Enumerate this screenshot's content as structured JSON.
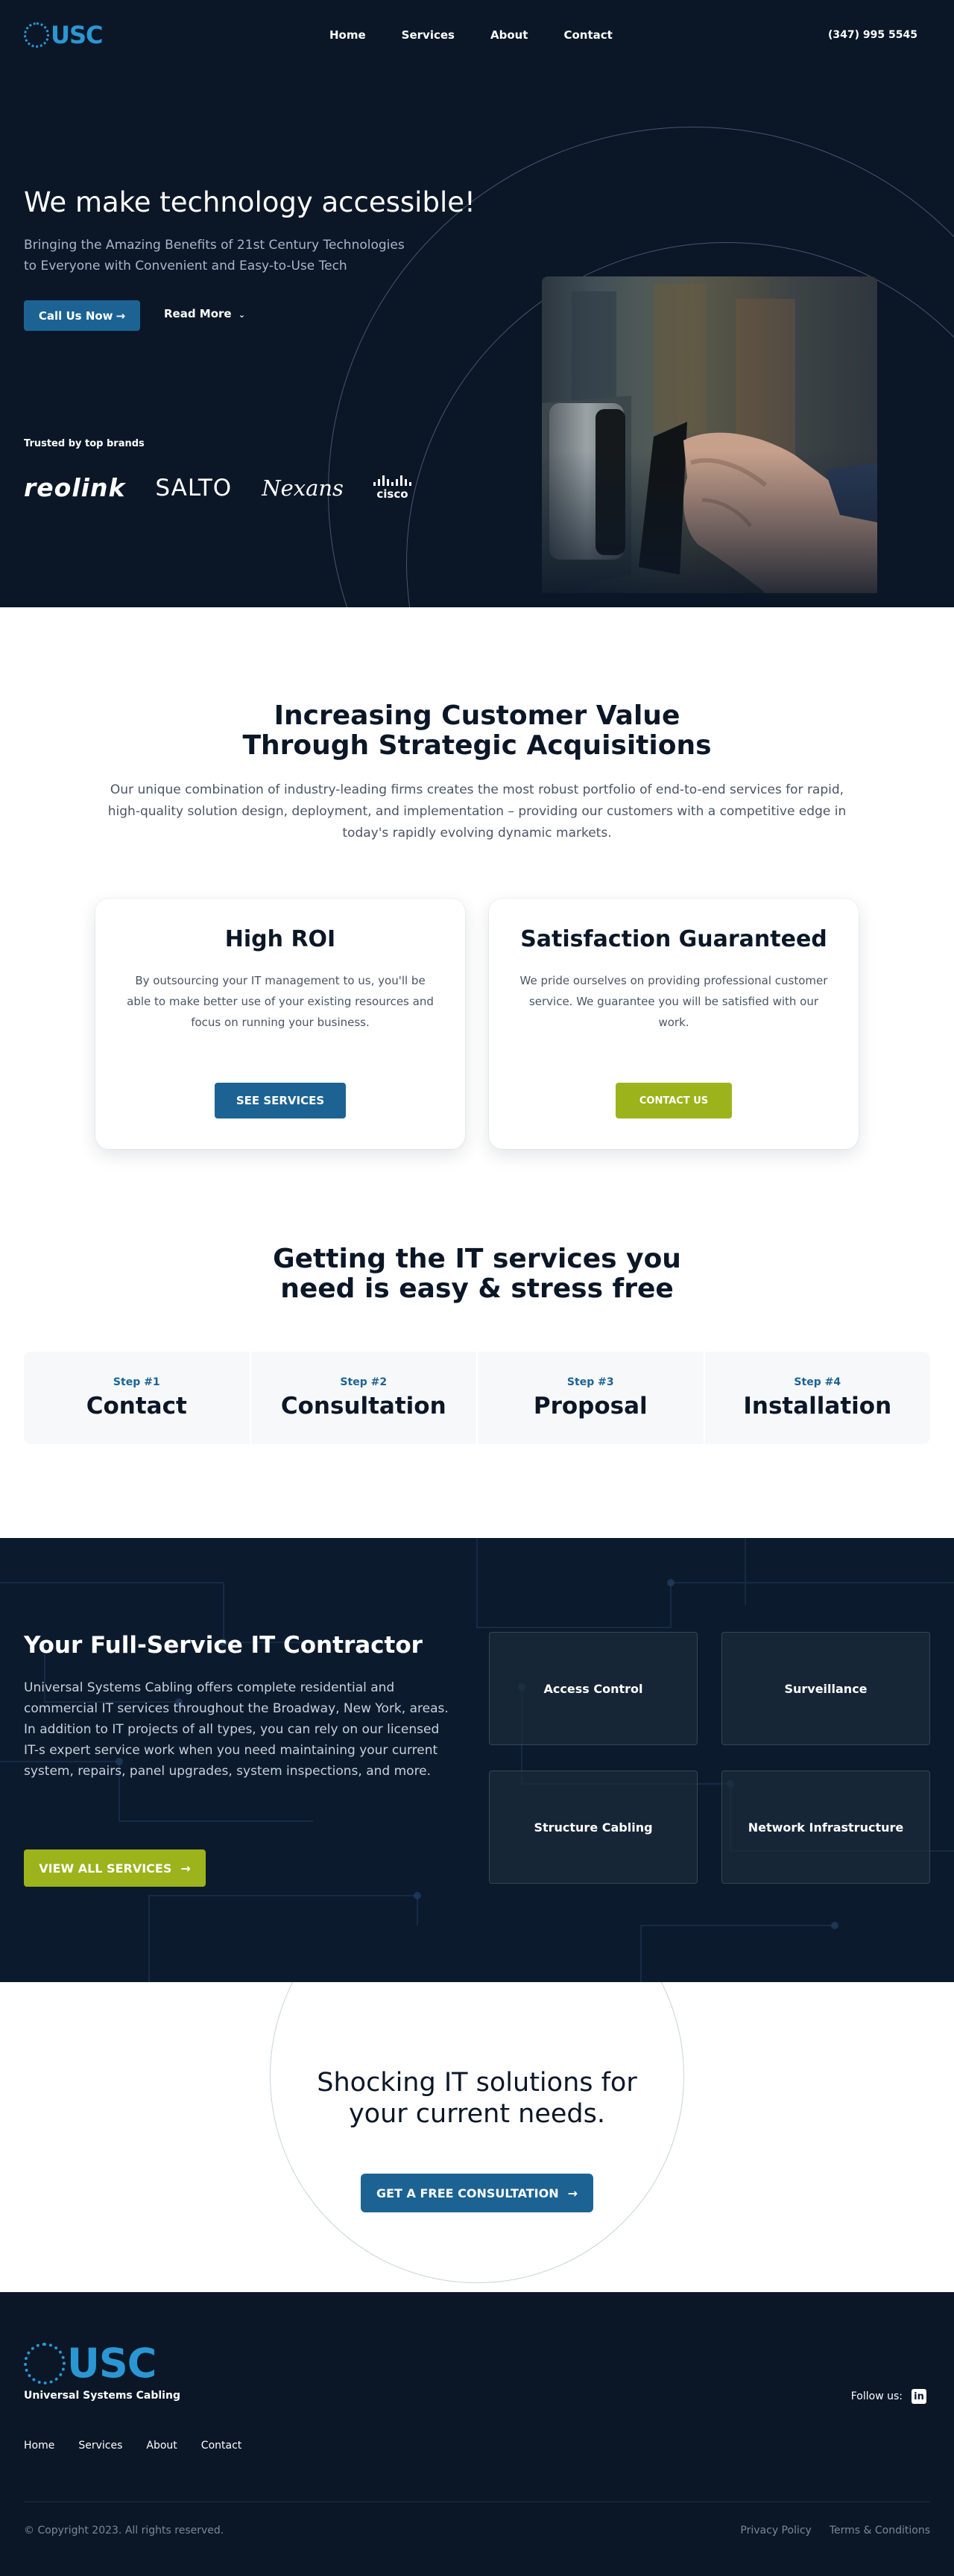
{
  "nav": {
    "logo": "USC",
    "links": [
      "Home",
      "Services",
      "About",
      "Contact"
    ],
    "phone": "(347) 995 5545"
  },
  "hero": {
    "title": "We make technology accessible!",
    "subtitle_line1": "Bringing the Amazing Benefits of 21st Century Technologies",
    "subtitle_line2": "to Everyone with Convenient and Easy-to-Use Tech",
    "cta_primary": "Call Us Now",
    "cta_secondary": "Read More",
    "trusted_label": "Trusted by top brands",
    "brands": [
      "reolink",
      "SALTO",
      "Nexans",
      "cisco"
    ]
  },
  "acquisitions": {
    "title_line1": "Increasing Customer Value",
    "title_line2": "Through Strategic Acquisitions",
    "lead": "Our unique combination of industry-leading firms creates the most robust portfolio of end-to-end services for rapid, high-quality solution design, deployment, and implementation – providing our customers with a competitive edge in today's rapidly evolving dynamic markets.",
    "cards": [
      {
        "title": "High ROI",
        "text": "By outsourcing your IT management to us, you'll be able to make better use of your existing resources and focus on running your business.",
        "button": "SEE SERVICES"
      },
      {
        "title": "Satisfaction Guaranteed",
        "text": "We pride ourselves on providing professional customer service. We guarantee you will be satisfied with our work.",
        "button": "CONTACT US"
      }
    ]
  },
  "steps": {
    "title_line1": "Getting the IT services you",
    "title_line2": "need is easy & stress free",
    "items": [
      {
        "num": "Step #1",
        "name": "Contact"
      },
      {
        "num": "Step #2",
        "name": "Consultation"
      },
      {
        "num": "Step #3",
        "name": "Proposal"
      },
      {
        "num": "Step #4",
        "name": "Installation"
      }
    ]
  },
  "contractor": {
    "title": "Your Full-Service IT Contractor",
    "text": "Universal Systems Cabling offers complete residential and commercial IT services throughout the Broadway, New York, areas. In addition to IT projects of all types, you can rely on our licensed IT-s expert service work when you need maintaining your current system, repairs, panel upgrades, system inspections, and more.",
    "button": "VIEW ALL SERVICES",
    "services": [
      "Access Control",
      "Surveillance",
      "Structure Cabling",
      "Network Infrastructure"
    ]
  },
  "shock": {
    "title_line1": "Shocking IT solutions for",
    "title_line2": "your current needs.",
    "button": "GET A FREE CONSULTATION"
  },
  "footer": {
    "logo": "USC",
    "company": "Universal Systems Cabling",
    "follow": "Follow us:",
    "links": [
      "Home",
      "Services",
      "About",
      "Contact"
    ],
    "copyright": "© Copyright 2023. All rights reserved.",
    "privacy": "Privacy Policy",
    "terms": "Terms & Conditions"
  },
  "colors": {
    "navy": "#0b1727",
    "brand_blue": "#1c6394",
    "logo_blue": "#2a97d4",
    "lime": "#9cb31b"
  }
}
